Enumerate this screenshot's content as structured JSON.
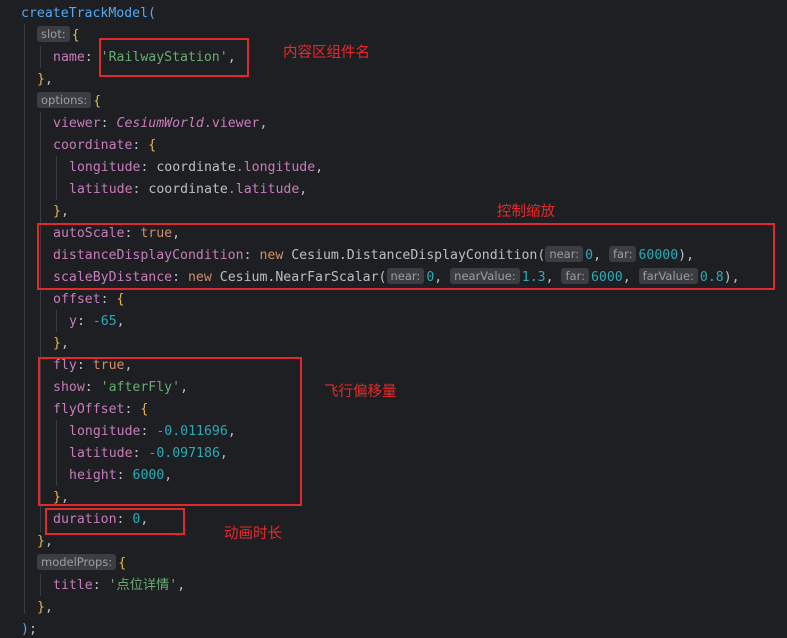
{
  "code": {
    "fn_name": "createTrackModel",
    "open_paren": "(",
    "hint_slot": "slot:",
    "key_name": "name",
    "val_name": "'RailwayStation'",
    "hint_options": "options:",
    "key_viewer": "viewer",
    "val_viewer_obj": "CesiumWorld",
    "val_viewer_prop": ".viewer",
    "key_coordinate": "coordinate",
    "key_longitude": "longitude",
    "val_coord_obj": "coordinate",
    "val_coord_lon": ".longitude",
    "key_latitude": "latitude",
    "val_coord_lat": ".latitude",
    "key_autoScale": "autoScale",
    "val_true": "true",
    "key_ddc": "distanceDisplayCondition",
    "kw_new": "new",
    "cls_ddc": "Cesium.DistanceDisplayCondition(",
    "hint_near": "near:",
    "hint_far": "far:",
    "num_0": "0",
    "num_60000": "60000",
    "key_sbd": "scaleByDistance",
    "cls_nfs": "Cesium.NearFarScalar(",
    "hint_nearValue": "nearValue:",
    "hint_farValue": "farValue:",
    "num_1_3": "1.3",
    "num_6000": "6000",
    "num_0_8": "0.8",
    "key_offset": "offset",
    "key_y": "y",
    "num_neg65": "-65",
    "key_fly": "fly",
    "key_show": "show",
    "val_afterFly": "'afterFly'",
    "key_flyOffset": "flyOffset",
    "num_lon": "-0.011696",
    "num_lat": "-0.097186",
    "key_height": "height",
    "key_duration": "duration",
    "hint_modelProps": "modelProps:",
    "key_title": "title",
    "val_title": "'点位详情'",
    "close_paren": ")",
    "semicolon": ";"
  },
  "annotations": {
    "component_name": "内容区组件名",
    "control_scale": "控制缩放",
    "fly_offset": "飞行偏移量",
    "anim_duration": "动画时长"
  }
}
